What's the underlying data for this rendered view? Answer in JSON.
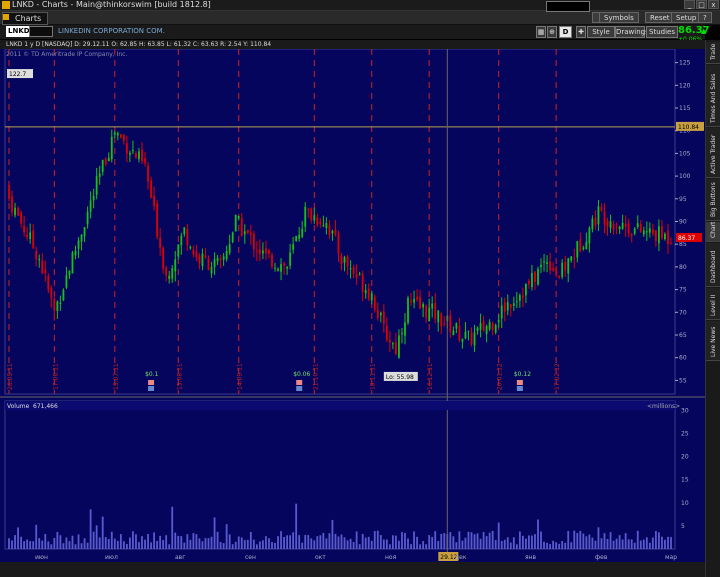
{
  "window": {
    "title": "LNKD - Charts - Main@thinkorswim [build 1812.8]",
    "minimize": "_",
    "maximize": "□",
    "close": "x"
  },
  "tab": {
    "label": "Charts"
  },
  "top_buttons": {
    "symbols": "Symbols",
    "reset": "Reset",
    "setup": "Setup",
    "help": "?"
  },
  "toolbar": {
    "symbol": "LNKD",
    "company": "LINKEDIN CORPORATION COM.",
    "period_label": "D",
    "style": "Style",
    "drawings": "Drawings",
    "studies": "Studies",
    "last_price": "86.37",
    "net_change": "+0.06%",
    "up_arrow": "▲"
  },
  "info_line": "LNKD 1 y D [NASDAQ]   D: 29.12.11   O: 62.85   H: 63.85   L: 61.32   C: 63.63   R: 2.54   Y: 110.84",
  "copyright": "2011 © TD Ameritrade IP Company, Inc.",
  "sidebar_tabs": [
    "Trade",
    "Times And Sales",
    "Active Trader",
    "Big Buttons",
    "Chart",
    "Dashboard",
    "Level II",
    "Live News"
  ],
  "colors": {
    "up": "#19c019",
    "down": "#e00000",
    "panel_bg": "#05055e",
    "dash": "#cc2222",
    "accent": "#e2a400"
  },
  "chart_data": {
    "type": "candlestick",
    "price_axis": {
      "ticks": [
        55,
        60,
        65,
        70,
        75,
        80,
        85,
        90,
        95,
        100,
        105,
        110,
        115,
        120,
        125
      ],
      "min": 52,
      "max": 128
    },
    "high_line": {
      "value": 110.84,
      "label": "110.84"
    },
    "high_marker": {
      "value": 122.7,
      "label": "122.7"
    },
    "low_marker": {
      "value": 55.98,
      "label": "Lo: 55.98"
    },
    "last_label": "86.37",
    "date_markers": [
      "26.05.11",
      "17.06.11",
      "15.07.11",
      "15.08.11",
      "14.09.11",
      "21.10.11",
      "18.11.11",
      "16.12.11",
      "20.01.12",
      "17.02.12"
    ],
    "crosshair_date": "29.12.11",
    "events": [
      {
        "label": "$0.1"
      },
      {
        "label": "$0.06"
      },
      {
        "label": "$0.12"
      }
    ],
    "volume": {
      "label": "Volume",
      "value": "671,466",
      "unit": "millions",
      "ticks": [
        5,
        10,
        15,
        20,
        25,
        30
      ]
    },
    "months": [
      "июн",
      "июл",
      "авг",
      "сен",
      "окт",
      "ноя",
      "дек",
      "янв",
      "фев",
      "мар"
    ]
  }
}
